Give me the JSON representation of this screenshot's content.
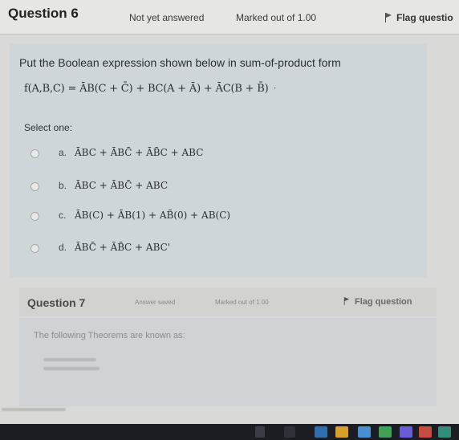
{
  "question6": {
    "title": "Question 6",
    "state": "Not yet answered",
    "mark": "Marked out of 1.00",
    "flag_label": "Flag questio",
    "prompt": "Put the Boolean expression shown below in sum-of-product form",
    "expression_text": "f(A,B,C) = ĀB(C + C̄) + BC(A + Ā) + ĀC(B + B̄)",
    "select_one": "Select one:",
    "options": [
      {
        "letter": "a.",
        "text": "ĀBC + ĀBC̄ + ĀB̄C + ABC"
      },
      {
        "letter": "b.",
        "text": "ĀBC + ĀBC̄ + ABC"
      },
      {
        "letter": "c.",
        "text": "ĀB(C) + ĀB(1) + AB̄(0) + AB(C)"
      },
      {
        "letter": "d.",
        "text": "ĀBC̄ + ĀB̄C + ABC'"
      }
    ]
  },
  "question7": {
    "title": "Question 7",
    "state": "Answer saved",
    "mark": "Marked out of 1.00",
    "flag_label": "Flag question",
    "prompt": "The following Theorems are known as:"
  },
  "colors": {
    "page_bg": "#d9d9d7",
    "content_box": "#cfd6da",
    "taskbar": "#1b1d22"
  }
}
